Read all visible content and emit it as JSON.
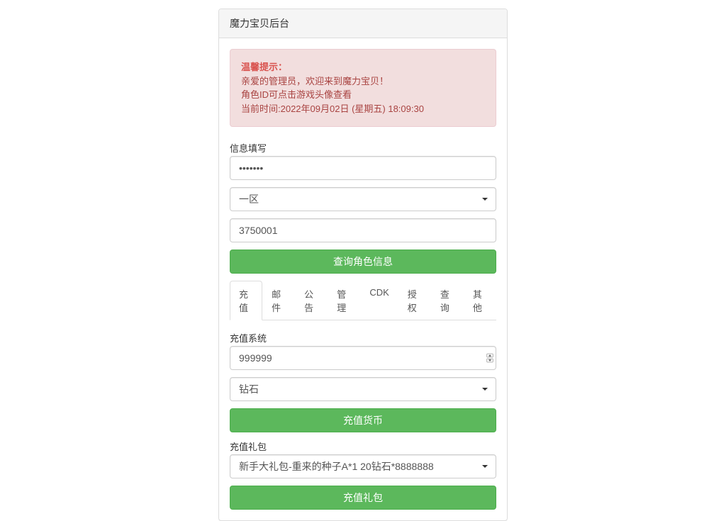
{
  "panel": {
    "title": "魔力宝贝后台"
  },
  "alert": {
    "heading": "温馨提示：",
    "line1": "亲爱的管理员，欢迎来到魔力宝贝！",
    "line2": "角色ID可点击游戏头像查看",
    "line3": "当前时间:2022年09月02日 (星期五) 18:09:30"
  },
  "info_section": {
    "label": "信息填写",
    "password_value": "•••••••",
    "zone_value": "一区",
    "role_id_value": "3750001",
    "query_button": "查询角色信息"
  },
  "tabs": [
    {
      "label": "充值",
      "active": true
    },
    {
      "label": "邮件",
      "active": false
    },
    {
      "label": "公告",
      "active": false
    },
    {
      "label": "管理",
      "active": false
    },
    {
      "label": "CDK",
      "active": false
    },
    {
      "label": "授权",
      "active": false
    },
    {
      "label": "查询",
      "active": false
    },
    {
      "label": "其他",
      "active": false
    }
  ],
  "recharge": {
    "system_label": "充值系统",
    "amount_value": "999999",
    "currency_value": "钻石",
    "currency_button": "充值货币",
    "gift_label": "充值礼包",
    "gift_value": "新手大礼包-重来的种子A*1 20钻石*8888888",
    "gift_button": "充值礼包"
  }
}
